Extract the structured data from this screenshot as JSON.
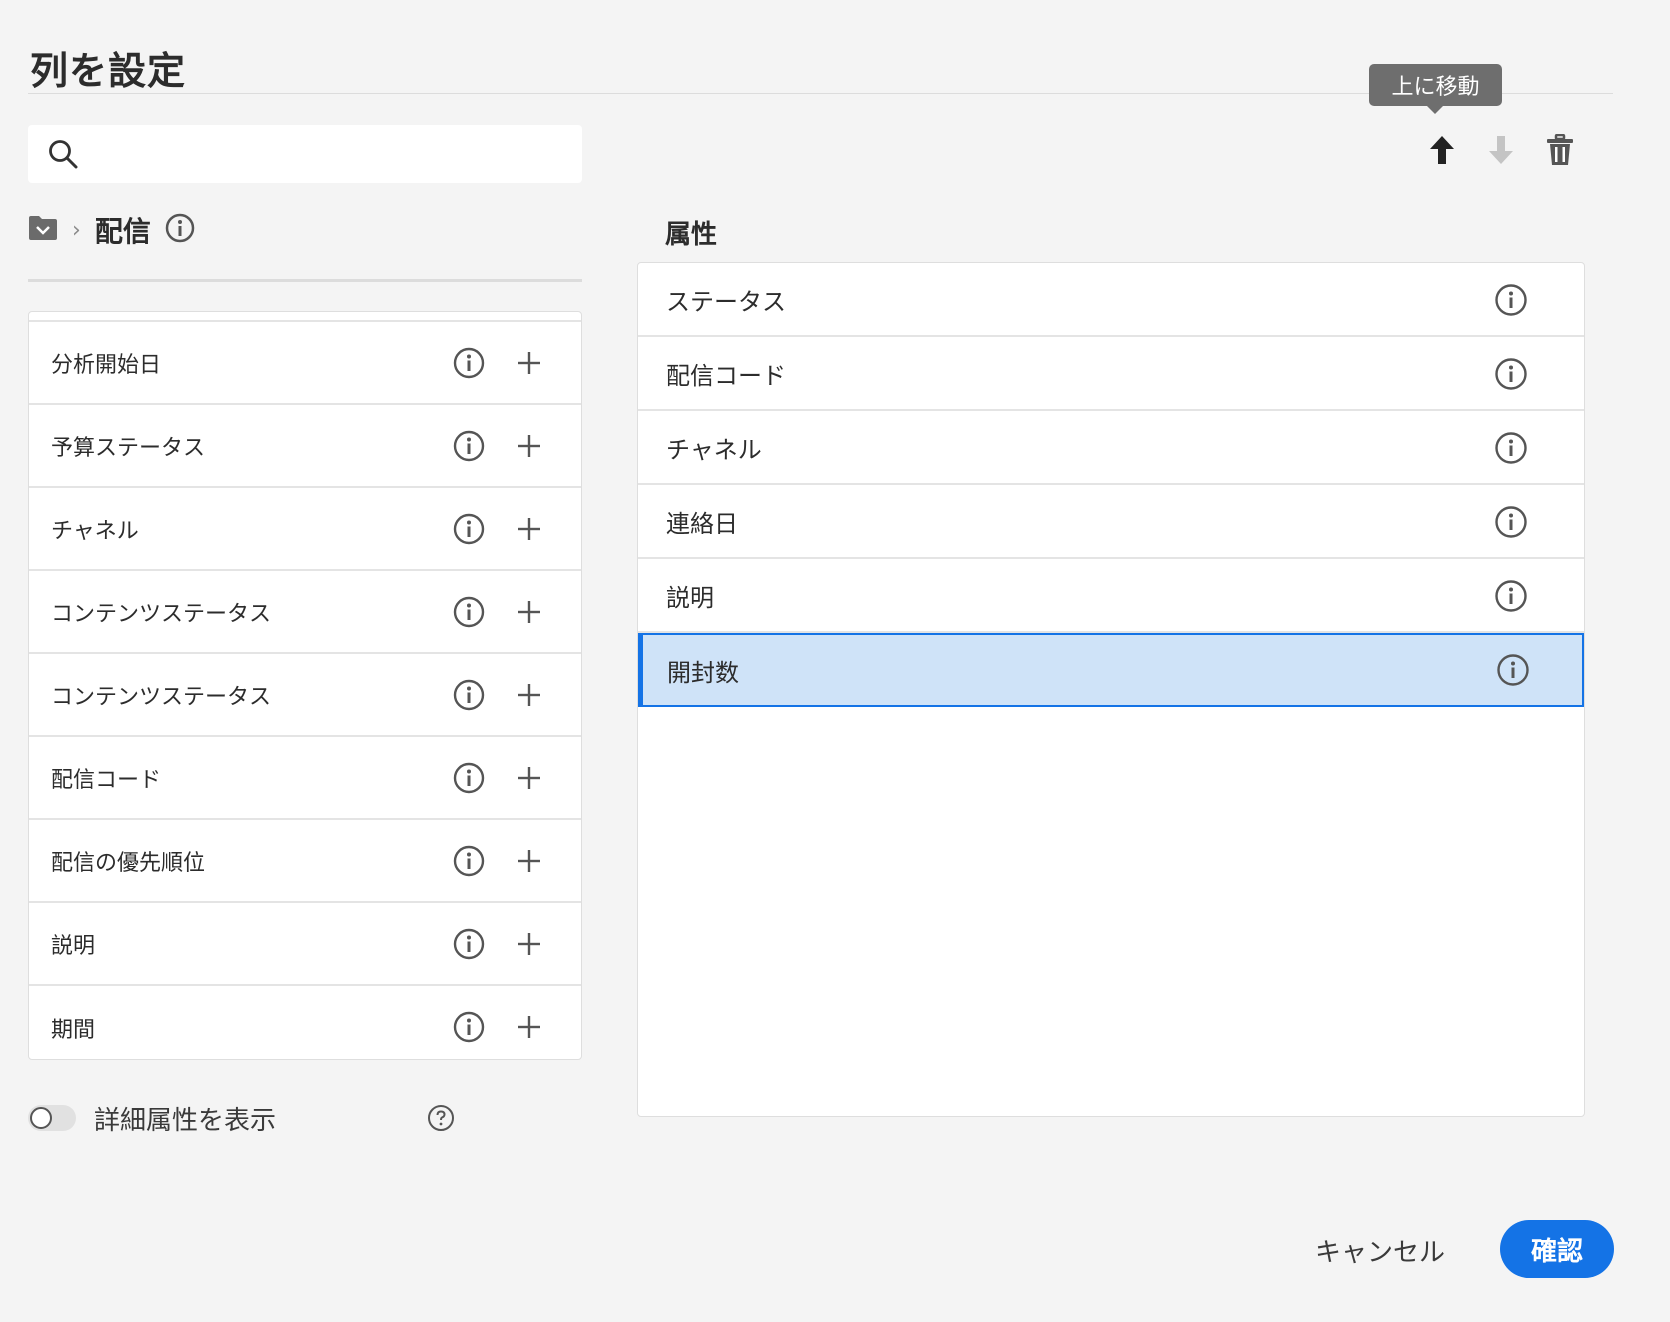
{
  "dialog": {
    "title": "列を設定"
  },
  "tooltip": {
    "text": "上に移動"
  },
  "toolbar": {
    "move_up_icon": "arrow-up-icon",
    "move_down_icon": "arrow-down-icon",
    "delete_icon": "trash-icon"
  },
  "search": {
    "value": "",
    "placeholder": ""
  },
  "breadcrumb": {
    "folder_icon": "folder-icon",
    "current": "配信"
  },
  "left_list": {
    "items": [
      {
        "label": "分析開始日"
      },
      {
        "label": "予算ステータス"
      },
      {
        "label": "チャネル"
      },
      {
        "label": "コンテンツステータス"
      },
      {
        "label": "コンテンツステータス"
      },
      {
        "label": "配信コード"
      },
      {
        "label": "配信の優先順位"
      },
      {
        "label": "説明"
      },
      {
        "label": "期間"
      }
    ]
  },
  "advanced_toggle": {
    "label": "詳細属性を表示",
    "checked": false
  },
  "attributes": {
    "heading": "属性",
    "items": [
      {
        "label": "ステータス",
        "selected": false
      },
      {
        "label": "配信コード",
        "selected": false
      },
      {
        "label": "チャネル",
        "selected": false
      },
      {
        "label": "連絡日",
        "selected": false
      },
      {
        "label": "説明",
        "selected": false
      },
      {
        "label": "開封数",
        "selected": true
      }
    ]
  },
  "footer": {
    "cancel_label": "キャンセル",
    "confirm_label": "確認"
  },
  "colors": {
    "accent": "#1473e6",
    "selected_bg": "#cfe3f8",
    "background": "#f4f4f4"
  }
}
